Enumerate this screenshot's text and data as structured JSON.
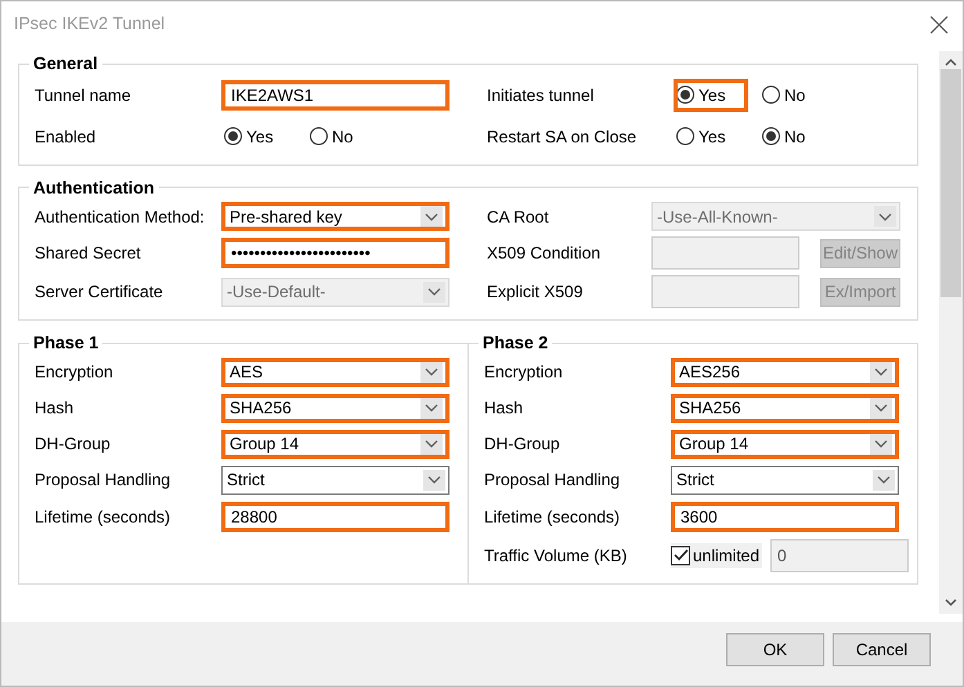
{
  "window": {
    "title": "IPsec IKEv2 Tunnel"
  },
  "general": {
    "title": "General",
    "fields": [
      {
        "label": "Tunnel name",
        "kind": "text",
        "value": "IKE2AWS1",
        "highlighted": true,
        "disabled": false
      },
      {
        "label": "Initiates tunnel",
        "kind": "radio",
        "options": [
          {
            "label": "Yes",
            "selected": true,
            "highlighted": true
          },
          {
            "label": "No",
            "selected": false,
            "highlighted": false
          }
        ]
      },
      {
        "label": "Enabled",
        "kind": "radio",
        "options": [
          {
            "label": "Yes",
            "selected": true,
            "highlighted": false
          },
          {
            "label": "No",
            "selected": false,
            "highlighted": false
          }
        ]
      },
      {
        "label": "Restart SA on Close",
        "kind": "radio",
        "options": [
          {
            "label": "Yes",
            "selected": false,
            "highlighted": false
          },
          {
            "label": "No",
            "selected": true,
            "highlighted": false
          }
        ]
      }
    ]
  },
  "authentication": {
    "title": "Authentication",
    "fields": [
      {
        "label": "Authentication Method:",
        "kind": "select",
        "value": "Pre-shared key",
        "highlighted": true,
        "disabled": false
      },
      {
        "label": "CA Root",
        "kind": "select",
        "value": "-Use-All-Known-",
        "highlighted": false,
        "disabled": true
      },
      {
        "label": "Shared Secret",
        "kind": "password",
        "value": "••••••••••••••••••••••••",
        "highlighted": true,
        "disabled": false
      },
      {
        "label": "X509 Condition",
        "kind": "field-button",
        "highlighted": false,
        "disabled": true,
        "button": {
          "label": "Edit/Show",
          "disabled": true
        }
      },
      {
        "label": "Server Certificate",
        "kind": "select",
        "value": "-Use-Default-",
        "highlighted": false,
        "disabled": true
      },
      {
        "label": "Explicit X509",
        "kind": "field-button",
        "highlighted": false,
        "disabled": true,
        "button": {
          "label": "Ex/Import",
          "disabled": true
        }
      }
    ]
  },
  "phases": [
    {
      "title": "Phase 1",
      "fields": [
        {
          "label": "Encryption",
          "kind": "select",
          "value": "AES",
          "highlighted": true,
          "disabled": false
        },
        {
          "label": "Hash",
          "kind": "select",
          "value": "SHA256",
          "highlighted": true,
          "disabled": false
        },
        {
          "label": "DH-Group",
          "kind": "select",
          "value": "Group 14",
          "highlighted": true,
          "disabled": false
        },
        {
          "label": "Proposal Handling",
          "kind": "select",
          "value": "Strict",
          "highlighted": false,
          "disabled": false
        },
        {
          "label": "Lifetime (seconds)",
          "kind": "text",
          "value": "28800",
          "highlighted": true,
          "disabled": false
        }
      ]
    },
    {
      "title": "Phase 2",
      "fields": [
        {
          "label": "Encryption",
          "kind": "select",
          "value": "AES256",
          "highlighted": true,
          "disabled": false
        },
        {
          "label": "Hash",
          "kind": "select",
          "value": "SHA256",
          "highlighted": true,
          "disabled": false
        },
        {
          "label": "DH-Group",
          "kind": "select",
          "value": "Group 14",
          "highlighted": true,
          "disabled": false
        },
        {
          "label": "Proposal Handling",
          "kind": "select",
          "value": "Strict",
          "highlighted": false,
          "disabled": false
        },
        {
          "label": "Lifetime (seconds)",
          "kind": "text",
          "value": "3600",
          "highlighted": true,
          "disabled": false
        },
        {
          "label": "Traffic Volume (KB)",
          "kind": "checkbox-field",
          "checkbox": {
            "label": "unlimited",
            "checked": true
          },
          "value": "0",
          "highlighted": false,
          "disabled": true
        }
      ]
    }
  ],
  "buttons": [
    {
      "label": "OK"
    },
    {
      "label": "Cancel"
    }
  ]
}
